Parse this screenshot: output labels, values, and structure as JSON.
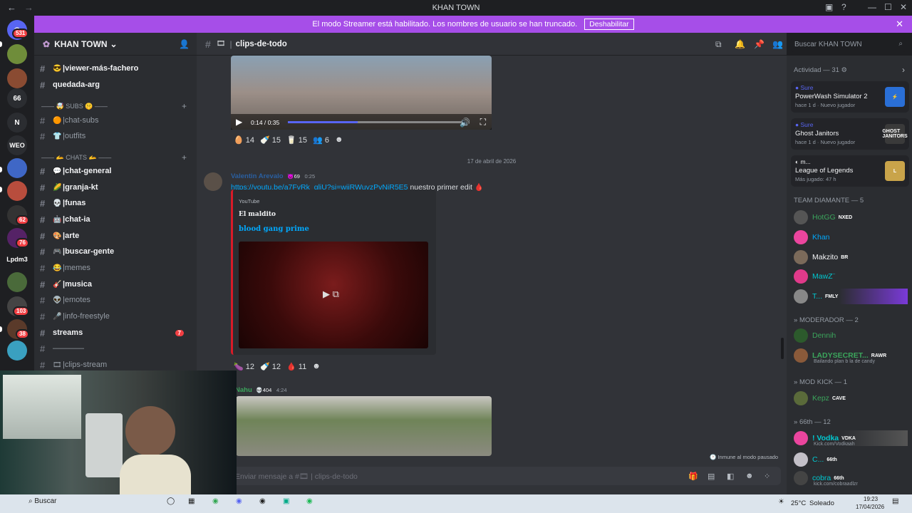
{
  "window": {
    "title": "KHAN TOWN",
    "back": "←",
    "forward": "→"
  },
  "banner": {
    "text": "El modo Streamer está habilitado. Los nombres de usuario se han truncado.",
    "button": "Deshabilitar"
  },
  "server_rail": {
    "dm_badge": "531",
    "items": [
      {
        "label": "",
        "badge": ""
      },
      {
        "label": "",
        "badge": ""
      },
      {
        "label": "66",
        "badge": ""
      },
      {
        "label": "N",
        "badge": ""
      },
      {
        "label": "WEO",
        "badge": ""
      },
      {
        "label": "",
        "badge": ""
      },
      {
        "label": "",
        "badge": ""
      },
      {
        "label": "",
        "badge": "62"
      },
      {
        "label": "",
        "badge": "76"
      },
      {
        "label": "Lpdm3",
        "badge": ""
      },
      {
        "label": "",
        "badge": ""
      },
      {
        "label": "",
        "badge": "103"
      },
      {
        "label": "",
        "badge": "38"
      },
      {
        "label": "",
        "badge": ""
      }
    ]
  },
  "server": {
    "name": "KHAN TOWN"
  },
  "channels": [
    {
      "name": "viewer-más-fachero",
      "emoji": "😎",
      "bold": true
    },
    {
      "name": "quedada-arg",
      "emoji": "",
      "bold": true,
      "nohash": true
    },
    {
      "name": "chat-subs",
      "emoji": "🟠",
      "bold": false
    },
    {
      "name": "outfits",
      "emoji": "👕",
      "bold": false
    },
    {
      "name": "chat-general",
      "emoji": "💬",
      "bold": true
    },
    {
      "name": "granja-kt",
      "emoji": "🌽",
      "bold": true
    },
    {
      "name": "funas",
      "emoji": "💀",
      "bold": true
    },
    {
      "name": "chat-ia",
      "emoji": "🤖",
      "bold": true
    },
    {
      "name": "arte",
      "emoji": "🎨",
      "bold": true
    },
    {
      "name": "buscar-gente",
      "emoji": "🎮",
      "bold": true
    },
    {
      "name": "memes",
      "emoji": "😂",
      "bold": false
    },
    {
      "name": "musica",
      "emoji": "🎸",
      "bold": true
    },
    {
      "name": "emotes",
      "emoji": "👽",
      "bold": false
    },
    {
      "name": "info-freestyle",
      "emoji": "🎤",
      "bold": false
    },
    {
      "name": "streams",
      "emoji": "",
      "bold": true,
      "nohash": true,
      "count": "7"
    },
    {
      "name": "————",
      "emoji": "",
      "bold": false
    },
    {
      "name": "clips-stream",
      "emoji": "🎞",
      "bold": false
    }
  ],
  "categories": {
    "subs": "—— 🤯 SUBS 🤫 ——",
    "chats": "—— 🫴 CHATS 🫴 ——"
  },
  "header": {
    "channel": "clips-de-todo",
    "search_placeholder": "Buscar KHAN TOWN"
  },
  "messages": {
    "video1": {
      "time": "0:14 / 0:35",
      "progress": 0.4
    },
    "reactions1": [
      {
        "emoji": "🥚",
        "count": "14"
      },
      {
        "emoji": "🍼",
        "count": "15"
      },
      {
        "emoji": "🥛",
        "count": "15"
      },
      {
        "emoji": "👥",
        "count": "6"
      }
    ],
    "date_divider": "17 de abril de 2026",
    "msg2": {
      "author": "Valentin Arevalo",
      "badge": "69",
      "time": "0:25",
      "link": "https://youtu.be/a7FvRk_gljU?si=wjiRWuvzPvNjR5E5",
      "text": "nuestro primer edit",
      "embed": {
        "provider": "YouTube",
        "author": "El maldito",
        "title": "blood gang prime"
      }
    },
    "reactions2": [
      {
        "emoji": "🍆",
        "count": "12"
      },
      {
        "emoji": "🍼",
        "count": "12"
      },
      {
        "emoji": "🩸",
        "count": "11"
      }
    ],
    "msg3": {
      "author": "Nahu",
      "badge": "404",
      "time": "4:24"
    }
  },
  "input": {
    "placeholder": "Enviar mensaje a #🎞 | clips-de-todo",
    "immune": "Inmune al modo pausado"
  },
  "members": {
    "activity_title": "Actividad — 31",
    "activities": [
      {
        "user": "Sure",
        "game": "PowerWash Simulator 2",
        "meta": "hace 1 d  ·  Nuevo jugador",
        "color": "#2a6fd6"
      },
      {
        "user": "Sure",
        "game": "Ghost Janitors",
        "meta": "hace 1 d  ·  Nuevo jugador",
        "color": "#3a3a3a"
      },
      {
        "user": "m...",
        "game": "League of Legends",
        "meta": "Más jugado: 47 h",
        "color": "#c9a44a"
      }
    ],
    "groups": [
      {
        "title": "TEAM DIAMANTE — 5",
        "members": [
          {
            "name": "HotGG",
            "tag": "NXED",
            "color": "#3ba55c",
            "sub": ""
          },
          {
            "name": "Khan",
            "tag": "",
            "color": "#00a8fc",
            "sub": ""
          },
          {
            "name": "Makzito",
            "tag": "BR",
            "color": "#f2f3f5",
            "sub": ""
          },
          {
            "name": "MawZ¨",
            "tag": "",
            "color": "#00c8d0",
            "sub": ""
          },
          {
            "name": "T...",
            "tag": "FMLY",
            "color": "#00c8d0",
            "sub": ""
          }
        ]
      },
      {
        "title": "MODERADOR — 2",
        "members": [
          {
            "name": "Dennih",
            "tag": "",
            "color": "#3ba55c",
            "sub": ""
          },
          {
            "name": "LADYSECRET...",
            "tag": "RAWR",
            "color": "#3ba55c",
            "sub": "Bailando plan b la de candy"
          }
        ]
      },
      {
        "title": "MOD KICK — 1",
        "members": [
          {
            "name": "Kepz",
            "tag": "CAVE",
            "color": "#3ba55c",
            "sub": ""
          }
        ]
      },
      {
        "title": "66th — 12",
        "members": [
          {
            "name": "! Vodka",
            "tag": "VDKA",
            "color": "#00c8d0",
            "sub": "Kick.com/Vodkaah"
          },
          {
            "name": "C...",
            "tag": "66th",
            "color": "#00c8d0",
            "sub": ""
          },
          {
            "name": "cobra",
            "tag": "66th",
            "color": "#00c8d0",
            "sub": "kick.com/cobraadlzr"
          }
        ]
      }
    ]
  },
  "taskbar": {
    "search": "Buscar",
    "weather": "25°C",
    "weather_text": "Soleado",
    "time": "19:23",
    "date": "17/04/2026"
  }
}
